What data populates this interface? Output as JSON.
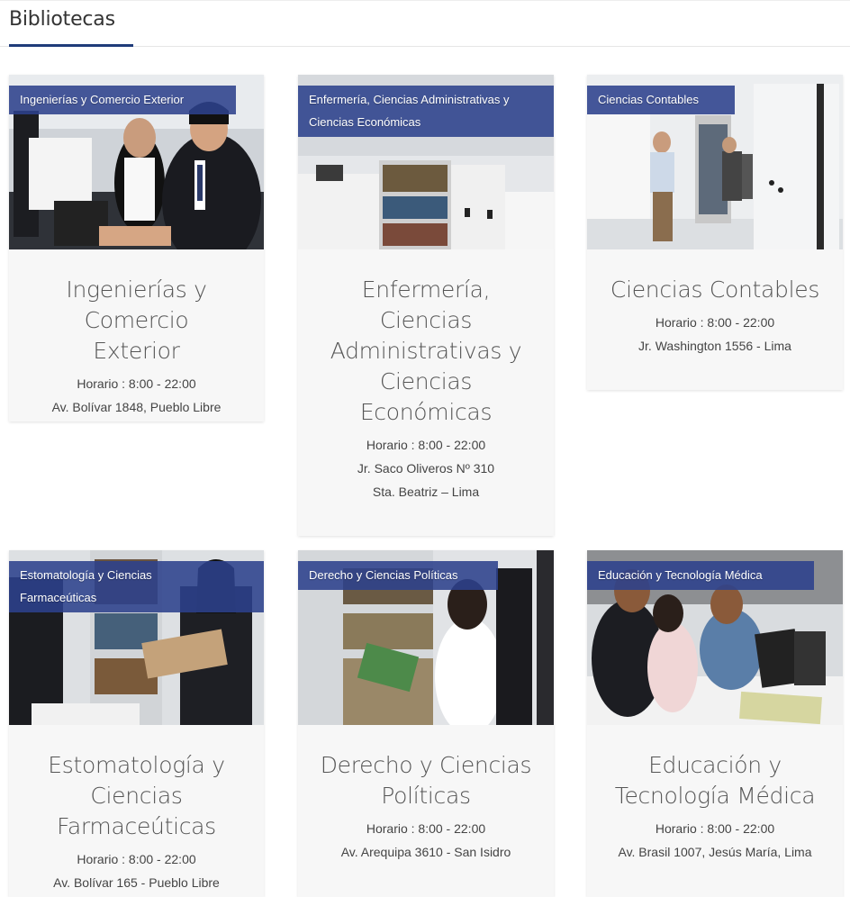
{
  "page": {
    "title": "Bibliotecas"
  },
  "cards": [
    {
      "tag": "Ingenierías y Comercio Exterior",
      "title": "Ingenierías y Comercio Exterior",
      "hours": "Horario : 8:00 - 22:00",
      "address": "Av. Bolívar 1848, Pueblo Libre"
    },
    {
      "tag": "Enfermería, Ciencias Administrativas y Ciencias Económicas",
      "title": "Enfermería, Ciencias Administrativas y Ciencias Económicas",
      "hours": "Horario : 8:00 - 22:00",
      "address": "Jr. Saco Oliveros Nº 310 Sta. Beatriz – Lima"
    },
    {
      "tag": "Ciencias Contables",
      "title": "Ciencias Contables",
      "hours": "Horario : 8:00 - 22:00",
      "address": "Jr. Washington 1556 - Lima"
    },
    {
      "tag": "Estomatología y Ciencias Farmaceúticas",
      "title": "Estomatología y Ciencias Farmaceúticas",
      "hours": "Horario : 8:00 - 22:00",
      "address": "Av. Bolívar 165 - Pueblo Libre"
    },
    {
      "tag": "Derecho y Ciencias Políticas",
      "title": "Derecho y Ciencias Políticas",
      "hours": "Horario : 8:00 - 22:00",
      "address": "Av. Arequipa 3610 - San Isidro"
    },
    {
      "tag": "Educación y Tecnología Médica",
      "title": "Educación y Tecnología Médica",
      "hours": "Horario : 8:00 - 22:00",
      "address": "Av. Brasil 1007, Jesús María, Lima"
    }
  ],
  "colors": {
    "accent": "#1f3c7a",
    "tag_bg": "#2c418c",
    "card_bg": "#f7f7f7"
  }
}
